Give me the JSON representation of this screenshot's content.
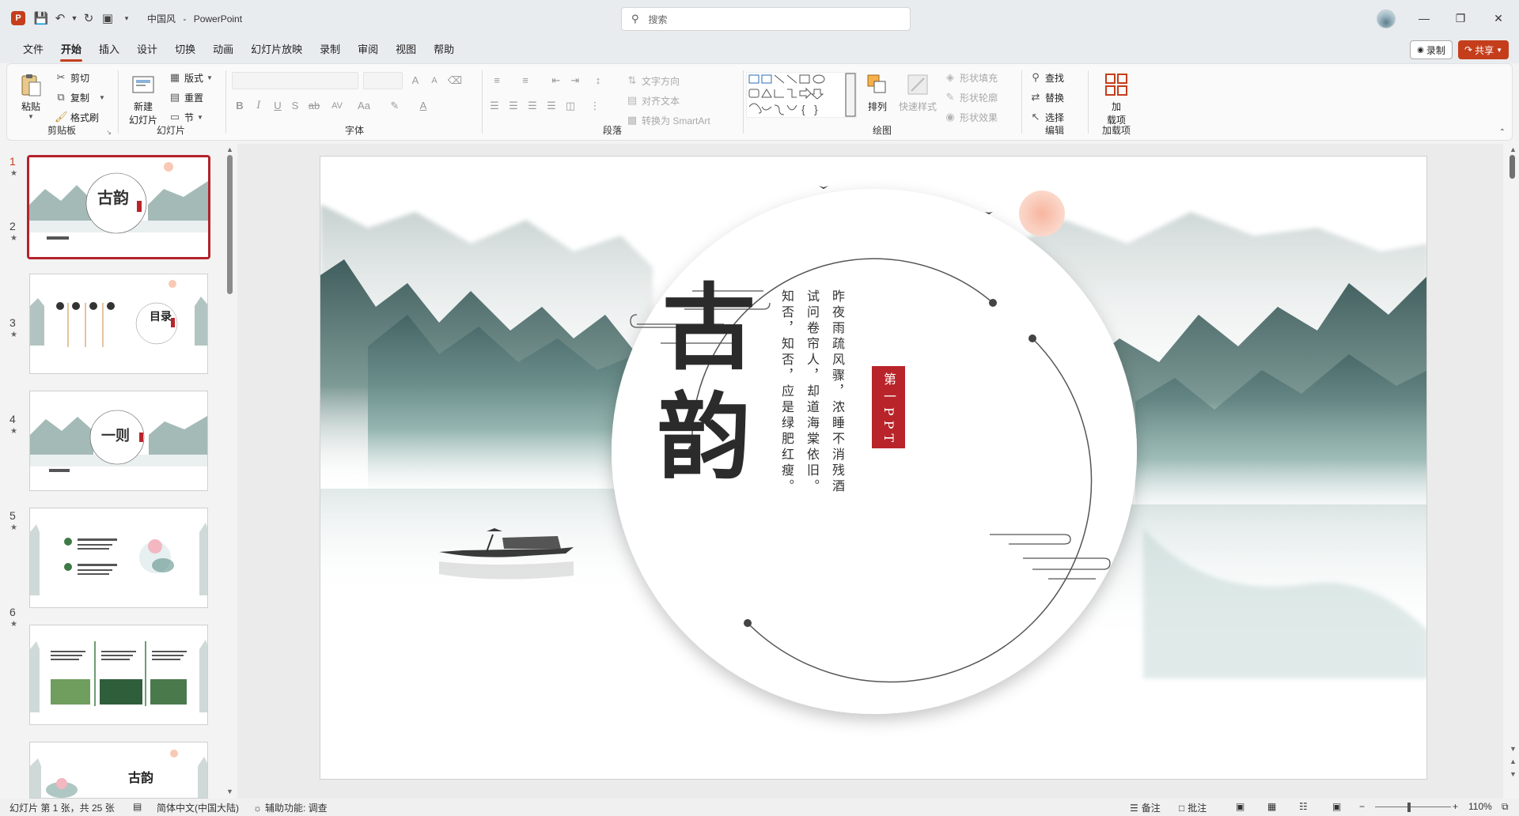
{
  "titlebar": {
    "doc_name": "中国风",
    "app_name": "PowerPoint",
    "separator": "-",
    "search_placeholder": "搜索",
    "app_logo": "P"
  },
  "menu": {
    "tabs": [
      "文件",
      "开始",
      "插入",
      "设计",
      "切换",
      "动画",
      "幻灯片放映",
      "录制",
      "审阅",
      "视图",
      "帮助"
    ],
    "active": "开始",
    "record_label": "录制",
    "share_label": "共享"
  },
  "ribbon": {
    "clipboard": {
      "paste": "粘贴",
      "cut": "剪切",
      "copy": "复制",
      "format_painter": "格式刷",
      "label": "剪贴板"
    },
    "slides": {
      "new_slide_line1": "新建",
      "new_slide_line2": "幻灯片",
      "layout": "版式",
      "reset": "重置",
      "section": "节",
      "label": "幻灯片"
    },
    "font": {
      "label": "字体",
      "bold": "B",
      "italic": "I",
      "underline": "U",
      "shadow": "S",
      "strike": "ab",
      "spacing": "AV",
      "case": "Aa",
      "grow": "A",
      "shrink": "A"
    },
    "paragraph": {
      "label": "段落",
      "text_direction": "文字方向",
      "align_text": "对齐文本",
      "convert_smartart": "转换为 SmartArt"
    },
    "drawing": {
      "label": "绘图",
      "arrange": "排列",
      "quick_styles": "快速样式",
      "shape_fill": "形状填充",
      "shape_outline": "形状轮廓",
      "shape_effects": "形状效果"
    },
    "editing": {
      "label": "编辑",
      "find": "查找",
      "replace": "替换",
      "select": "选择"
    },
    "addins": {
      "label": "加载项",
      "addins_line1": "加",
      "addins_line2": "载项"
    },
    "accent_color": "#c43e1c"
  },
  "thumbnails": [
    {
      "num": "1",
      "title": "古韵"
    },
    {
      "num": "2",
      "title": "目录"
    },
    {
      "num": "3",
      "title": "一则"
    },
    {
      "num": "4",
      "title": ""
    },
    {
      "num": "5",
      "title": ""
    },
    {
      "num": "6",
      "title": "古韵"
    }
  ],
  "slide": {
    "char1": "古",
    "char2": "韵",
    "poem_col1": "昨夜雨疏风骤，浓睡不消残酒",
    "poem_col2": "试问卷帘人，却道海棠依旧。",
    "poem_col3": "知否，知否，应是绿肥红瘦。",
    "seal_text": "第一PPT"
  },
  "statusbar": {
    "slide_info": "幻灯片 第 1 张，共 25 张",
    "language": "简体中文(中国大陆)",
    "accessibility": "辅助功能: 调查",
    "notes": "备注",
    "comments": "批注",
    "zoom": "110%"
  }
}
